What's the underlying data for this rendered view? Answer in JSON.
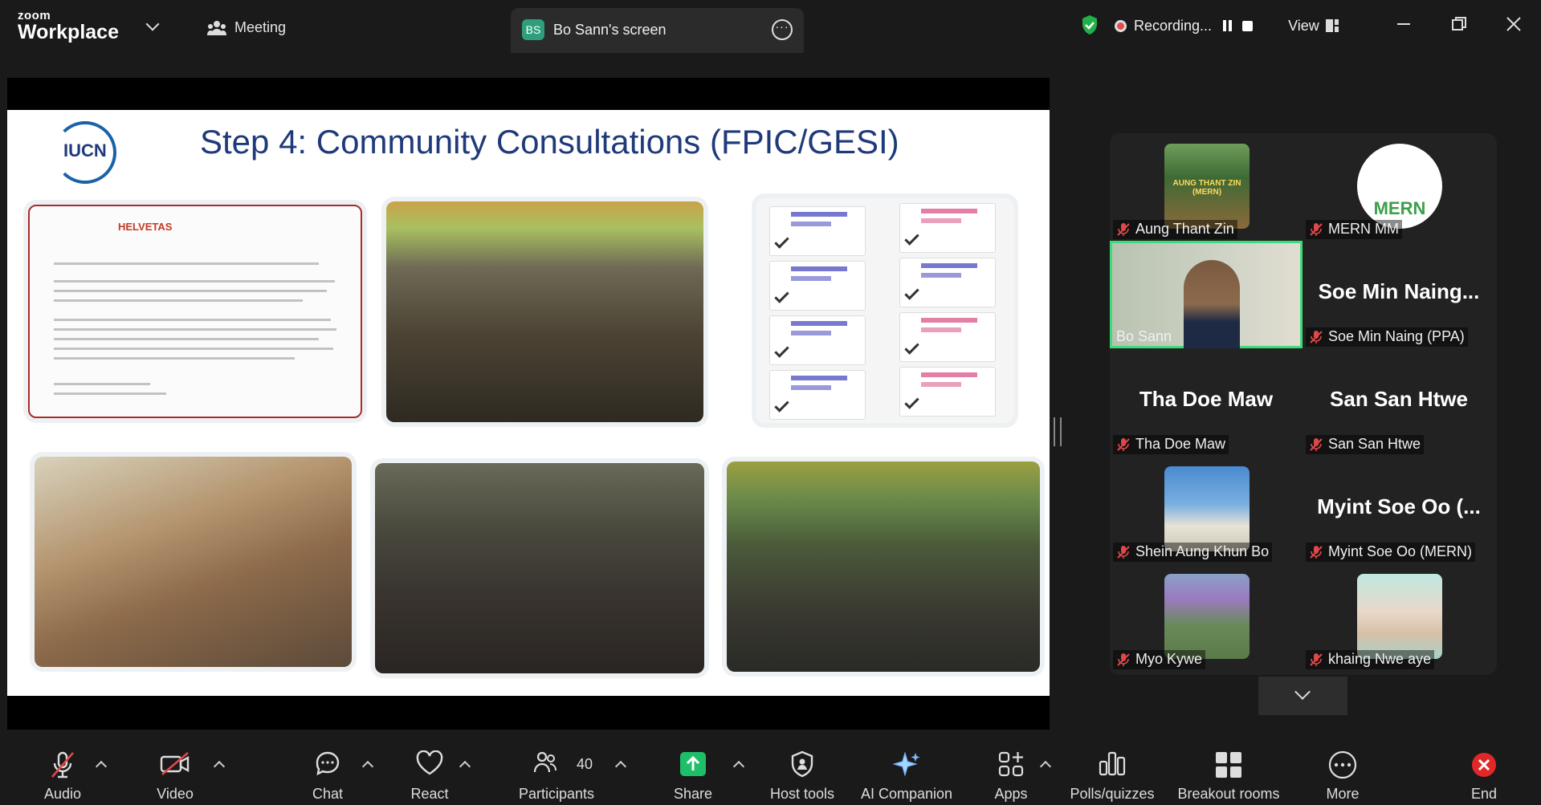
{
  "app": {
    "brand_top": "zoom",
    "brand_bottom": "Workplace"
  },
  "header": {
    "meeting_label": "Meeting",
    "tab_initials": "BS",
    "tab_title": "Bo Sann's screen",
    "recording_label": "Recording...",
    "view_label": "View"
  },
  "slide": {
    "title": "Step 4: Community Consultations (FPIC/GESI)",
    "logo_text": "IUCN",
    "doc_header": "HELVETAS"
  },
  "participants": [
    {
      "name": "Aung Thant Zin",
      "thumb_text": "AUNG THANT ZIN (MERN)"
    },
    {
      "name": "MERN MM",
      "thumb_text": "MERN"
    },
    {
      "name": "Bo Sann"
    },
    {
      "name": "Soe Min Naing (PPA)",
      "display": "Soe Min Naing..."
    },
    {
      "name": "Tha Doe Maw",
      "display": "Tha Doe Maw"
    },
    {
      "name": "San San Htwe",
      "display": "San San Htwe"
    },
    {
      "name": "Shein Aung Khun Bo"
    },
    {
      "name": "Myint Soe Oo (MERN)",
      "display": "Myint Soe Oo (..."
    },
    {
      "name": "Myo Kywe"
    },
    {
      "name": "khaing Nwe aye"
    }
  ],
  "toolbar": {
    "audio": "Audio",
    "video": "Video",
    "chat": "Chat",
    "react": "React",
    "participants": "Participants",
    "participant_count": "40",
    "share": "Share",
    "host_tools": "Host tools",
    "ai_companion": "AI Companion",
    "apps": "Apps",
    "polls": "Polls/quizzes",
    "breakout": "Breakout rooms",
    "more": "More",
    "end": "End"
  },
  "colors": {
    "accent_green": "#3ddc7a",
    "end_red": "#e02828",
    "share_green": "#1fbf6a",
    "mute_red": "#e04848"
  }
}
